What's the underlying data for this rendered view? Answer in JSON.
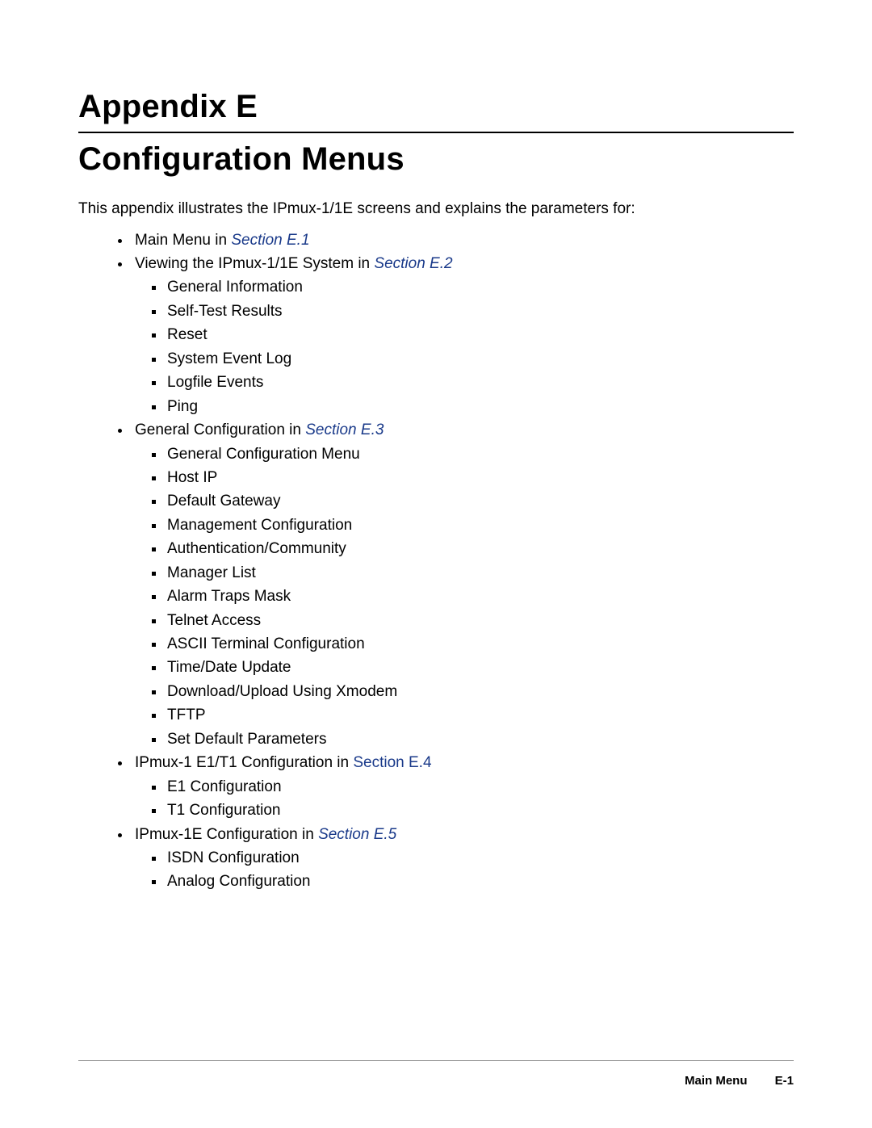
{
  "title_line1": "Appendix E",
  "title_line2": "Configuration Menus",
  "intro": "This appendix illustrates the IPmux-1/1E screens and explains the parameters for:",
  "items": [
    {
      "pre": "Main Menu in ",
      "link": "Section E.1",
      "link_italic": true
    },
    {
      "pre": "Viewing the IPmux-1/1E System in ",
      "link": "Section E.2",
      "link_italic": true,
      "sub": [
        "General Information",
        "Self-Test Results",
        "Reset",
        "System Event Log",
        "Logfile Events",
        "Ping"
      ]
    },
    {
      "pre": "General Configuration in ",
      "link": "Section E.3",
      "link_italic": true,
      "sub": [
        "General Configuration Menu",
        "Host IP",
        "Default Gateway",
        "Management Configuration",
        "Authentication/Community",
        "Manager List",
        "Alarm Traps Mask",
        "Telnet Access",
        "ASCII Terminal Configuration",
        "Time/Date Update",
        "Download/Upload Using Xmodem",
        "TFTP",
        "Set Default Parameters"
      ]
    },
    {
      "pre": "IPmux-1 E1/T1 Configuration in ",
      "link": "Section E.4",
      "link_italic": false,
      "sub": [
        "E1 Configuration",
        "T1 Configuration"
      ]
    },
    {
      "pre": "IPmux-1E Configuration in ",
      "link": "Section E.5",
      "link_italic": true,
      "sub": [
        "ISDN Configuration",
        "Analog Configuration"
      ]
    }
  ],
  "footer_label": "Main Menu",
  "footer_page": "E-1"
}
